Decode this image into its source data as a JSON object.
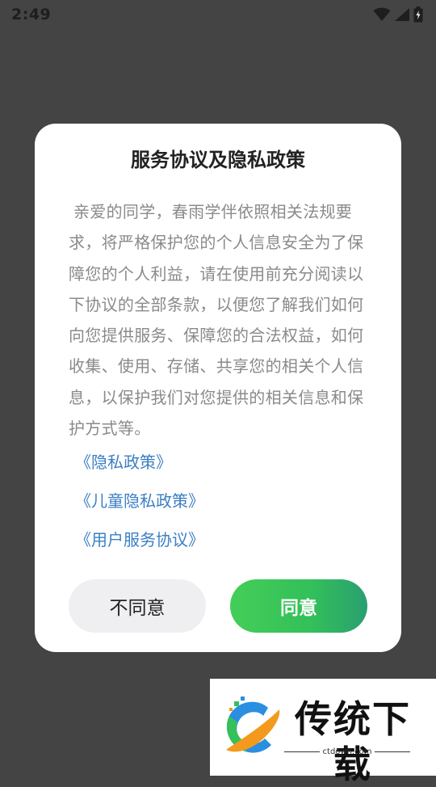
{
  "status_bar": {
    "time": "2:49",
    "icons": [
      "wifi-icon",
      "signal-icon",
      "battery-icon"
    ]
  },
  "dialog": {
    "title": "服务协议及隐私政策",
    "body": "亲爱的同学，春雨学伴依照相关法规要求，将严格保护您的个人信息安全为了保障您的个人利益，请在使用前充分阅读以下协议的全部条款，以便您了解我们如何向您提供服务、保障您的合法权益，如何收集、使用、存储、共享您的相关个人信息，以保护我们对您提供的相关信息和保护方式等。",
    "links": [
      {
        "label": "《隐私政策》"
      },
      {
        "label": "《儿童隐私政策》"
      },
      {
        "label": "《用户服务协议》"
      }
    ],
    "disagree_label": "不同意",
    "agree_label": "同意"
  },
  "watermark": {
    "brand": "传统下载",
    "domain": "ctdown.com"
  },
  "colors": {
    "overlay": "#444444",
    "link": "#3b7fc4",
    "agree_gradient_start": "#44ce58",
    "agree_gradient_end": "#2a9f70",
    "disagree_bg": "#efeff1"
  }
}
